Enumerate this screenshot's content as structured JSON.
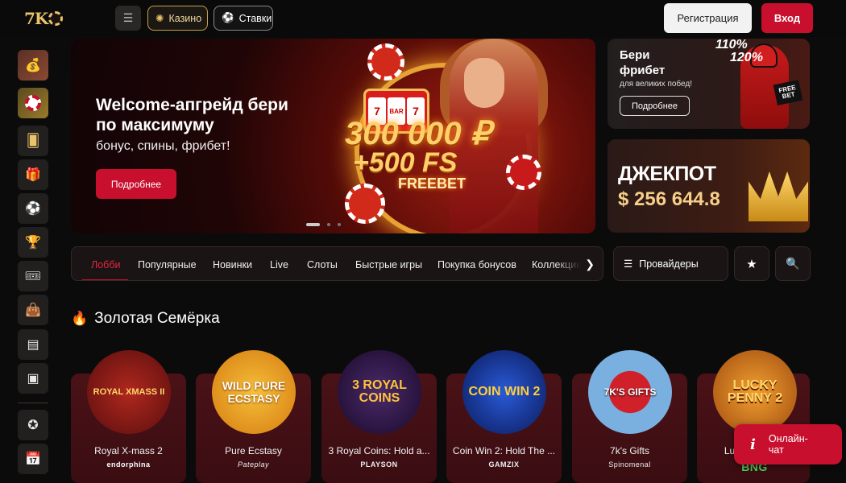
{
  "brand": {
    "logo_text": "7K"
  },
  "header": {
    "casino_label": "Казино",
    "bets_label": "Ставки",
    "register_label": "Регистрация",
    "login_label": "Вход"
  },
  "sidebar": {
    "items": [
      "money-bag-icon",
      "roulette-icon",
      "cards-icon",
      "gift-icon",
      "football-icon",
      "trophy-icon",
      "ticket-icon",
      "shop-icon",
      "archive-icon",
      "coupon-icon",
      "vip-icon",
      "calendar-icon"
    ]
  },
  "hero": {
    "title": "Welcome-апгрейд бери по максимуму",
    "subtitle": "бонус, спины, фрибет!",
    "button": "Подробнее",
    "amount": "300 000 ₽",
    "fs": "+500 FS",
    "freebet": "FREEBET",
    "slot_reels": [
      "7",
      "BAR",
      "7"
    ]
  },
  "promo_freebet": {
    "title": "Бери фрибет",
    "subtitle": "для великих побед!",
    "button": "Подробнее",
    "pct1": "110%",
    "pct2": "120%",
    "sign": "FREE BET"
  },
  "promo_jackpot": {
    "title": "ДЖЕКПОТ",
    "value": "$ 256 644.8"
  },
  "nav": {
    "tabs": [
      "Лобби",
      "Популярные",
      "Новинки",
      "Live",
      "Слоты",
      "Быстрые игры",
      "Покупка бонусов",
      "Коллекции"
    ],
    "providers_label": "Провайдеры"
  },
  "section": {
    "title": "Золотая Семёрка"
  },
  "games": [
    {
      "name": "Royal X-mass 2",
      "provider": "endorphina",
      "art": "ROYAL XMASS II",
      "color": "#8b1a1a"
    },
    {
      "name": "Pure Ecstasy",
      "provider": "Pateplay",
      "art": "WILD PURE ECSTASY",
      "color": "#e8a020"
    },
    {
      "name": "3 Royal Coins: Hold a...",
      "provider": "PLAYSON",
      "art": "3 ROYAL COINS",
      "color": "#2a1a4a"
    },
    {
      "name": "Coin Win 2: Hold The ...",
      "provider": "GAMZIX",
      "art": "COIN WIN 2",
      "color": "#1a3a8a"
    },
    {
      "name": "7k's Gifts",
      "provider": "Spinomenal",
      "art": "7K'S GIFTS",
      "color": "#5aa0d8"
    },
    {
      "name": "Lu",
      "provider": "BNG",
      "art": "LUCKY PENNY 2",
      "color": "#e07a1a"
    }
  ],
  "chat": {
    "label": "Онлайн-чат"
  }
}
